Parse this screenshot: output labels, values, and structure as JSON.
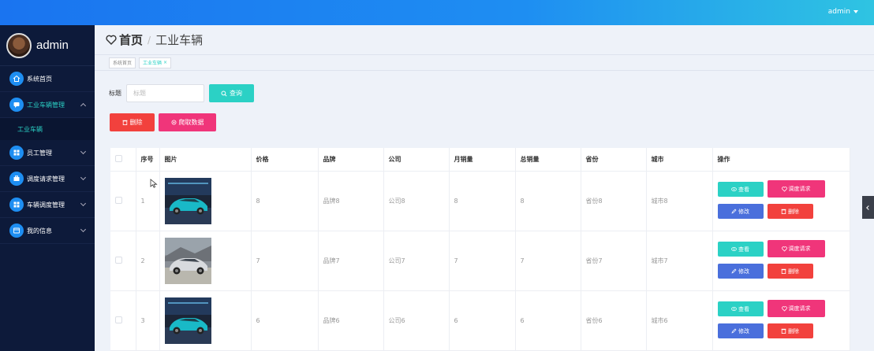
{
  "header": {
    "user": "admin"
  },
  "sidebar": {
    "username": "admin",
    "items": [
      {
        "label": "系统首页",
        "icon": "home-icon"
      },
      {
        "label": "工业车辆管理",
        "icon": "chat-icon",
        "active": true,
        "sub": [
          {
            "label": "工业车辆"
          }
        ]
      },
      {
        "label": "员工管理",
        "icon": "grid-icon"
      },
      {
        "label": "调度请求管理",
        "icon": "briefcase-icon"
      },
      {
        "label": "车辆调度管理",
        "icon": "grid-icon"
      },
      {
        "label": "我的信息",
        "icon": "profile-icon"
      }
    ]
  },
  "page": {
    "home": "首页",
    "separator": "/",
    "current": "工业车辆"
  },
  "tabs": [
    {
      "label": "系统首页"
    },
    {
      "label": "工业车辆",
      "active": true,
      "close": "×"
    }
  ],
  "search": {
    "label": "标题",
    "placeholder": "标题",
    "button": "查询"
  },
  "actions": {
    "delete": "删除",
    "crawl": "爬取数据"
  },
  "table": {
    "headers": [
      "",
      "序号",
      "图片",
      "价格",
      "品牌",
      "公司",
      "月销量",
      "总销量",
      "省份",
      "城市",
      "操作"
    ],
    "rows": [
      {
        "index": "1",
        "price": "8",
        "brand": "品牌8",
        "company": "公司8",
        "monthly": "8",
        "total": "8",
        "province": "省份8",
        "city": "城市8",
        "img": "car-teal"
      },
      {
        "index": "2",
        "price": "7",
        "brand": "品牌7",
        "company": "公司7",
        "monthly": "7",
        "total": "7",
        "province": "省份7",
        "city": "城市7",
        "img": "car-silver"
      },
      {
        "index": "3",
        "price": "6",
        "brand": "品牌6",
        "company": "公司6",
        "monthly": "6",
        "total": "6",
        "province": "省份6",
        "city": "城市6",
        "img": "car-teal"
      }
    ],
    "ops": {
      "view": "查看",
      "dispatch": "调度请求",
      "edit": "修改",
      "delete": "删除"
    }
  },
  "colors": {
    "primary": "#2bd1c5",
    "danger": "#f2413d",
    "pink": "#f0357a",
    "edit": "#4a6fdc",
    "sidebar": "#0d1a3a"
  }
}
